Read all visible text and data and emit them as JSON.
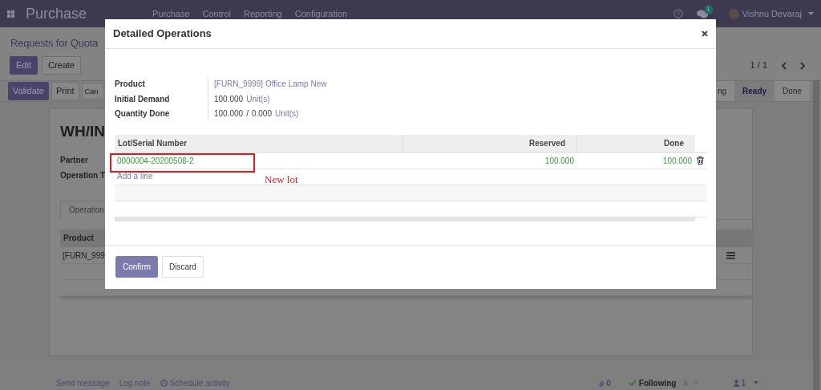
{
  "navbar": {
    "app_title": "Purchase",
    "menu": [
      "Purchase",
      "Control",
      "Reporting",
      "Configuration"
    ],
    "message_count": "1",
    "user": "Vishnu Devaraj"
  },
  "control_panel": {
    "breadcrumb": "Requests for Quota",
    "buttons": [
      {
        "label": "Edit",
        "primary": true
      },
      {
        "label": "Create",
        "primary": false
      }
    ],
    "pager": "1 / 1"
  },
  "status_row": {
    "buttons": [
      {
        "label": "Validate",
        "primary": true
      },
      {
        "label": "Print",
        "primary": false
      },
      {
        "label": "Can",
        "primary": false
      }
    ],
    "stages": [
      {
        "label": "ng",
        "selected": false
      },
      {
        "label": "Ready",
        "selected": true
      },
      {
        "label": "Done",
        "selected": false
      }
    ]
  },
  "sheet": {
    "title": "WH/IN",
    "fields": [
      "Partner",
      "Operation T"
    ],
    "tab": "Operation",
    "table": {
      "columns": [
        "Product"
      ],
      "rows": [
        [
          "[FURN_999"
        ]
      ]
    }
  },
  "chatter": {
    "actions": [
      {
        "label": "Send message",
        "kind": "plain"
      },
      {
        "label": "Log note",
        "kind": "plain"
      },
      {
        "label": "Schedule activity",
        "kind": "clock"
      }
    ],
    "attachments": "0",
    "following": "Following",
    "followers": "1"
  },
  "modal": {
    "title": "Detailed Operations",
    "fields": [
      {
        "label": "Product",
        "kind": "link",
        "value": "[FURN_9999] Office Lamp New"
      },
      {
        "label": "Initial Demand",
        "kind": "qty",
        "value": "100.000",
        "unit": "Unit(s)"
      },
      {
        "label": "Quantity Done",
        "kind": "ratio",
        "value": "100.000",
        "separator": "/",
        "value_2": "0.000",
        "unit": "Unit(s)"
      }
    ],
    "table": {
      "columns": [
        "Lot/Serial Number",
        "Reserved",
        "Done"
      ],
      "rows": [
        {
          "lot": "0000004-20200508-2",
          "reserved": "100.000",
          "done": "100.000"
        }
      ],
      "add_line": "Add a line"
    },
    "buttons": [
      {
        "label": "Confirm",
        "primary": true
      },
      {
        "label": "Discard",
        "primary": false
      }
    ]
  },
  "annotation": {
    "label": "New lot"
  }
}
